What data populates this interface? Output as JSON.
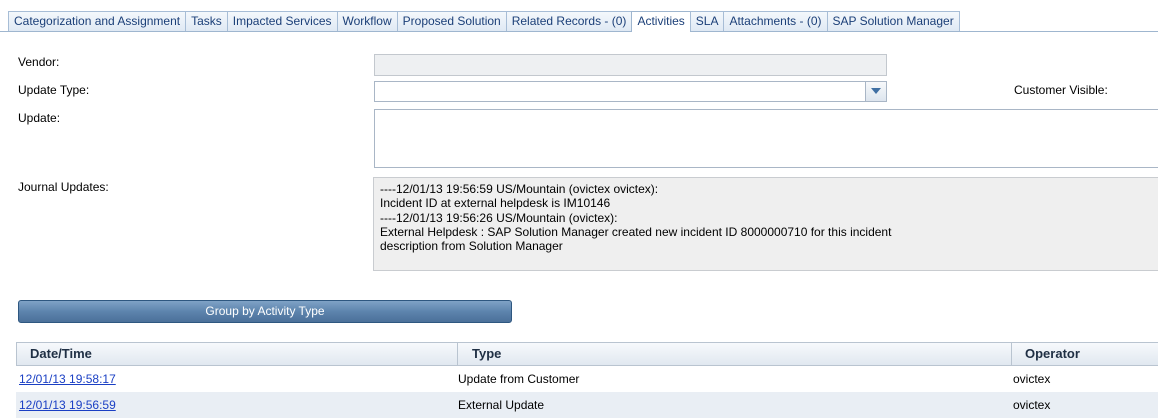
{
  "tabs": [
    {
      "label": "Categorization and Assignment",
      "active": false
    },
    {
      "label": "Tasks",
      "active": false
    },
    {
      "label": "Impacted Services",
      "active": false
    },
    {
      "label": "Workflow",
      "active": false
    },
    {
      "label": "Proposed Solution",
      "active": false
    },
    {
      "label": "Related Records - (0)",
      "active": false
    },
    {
      "label": "Activities",
      "active": true
    },
    {
      "label": "SLA",
      "active": false
    },
    {
      "label": "Attachments - (0)",
      "active": false
    },
    {
      "label": "SAP Solution Manager",
      "active": false
    }
  ],
  "form": {
    "vendor_label": "Vendor:",
    "vendor_value": "",
    "update_type_label": "Update Type:",
    "update_type_value": "",
    "customer_visible_label": "Customer Visible:",
    "update_label": "Update:",
    "update_value": "",
    "journal_label": "Journal Updates:",
    "journal_lines": [
      "----12/01/13 19:56:59 US/Mountain (ovictex ovictex):",
      "Incident ID at external helpdesk is IM10146",
      "----12/01/13 19:56:26 US/Mountain (ovictex):",
      "External Helpdesk : SAP Solution Manager created new incident ID 8000000710 for this incident",
      "description from Solution Manager"
    ]
  },
  "group_button_label": "Group by Activity Type",
  "activities": {
    "columns": [
      "Date/Time",
      "Type",
      "Operator"
    ],
    "rows": [
      {
        "datetime": "12/01/13 19:58:17",
        "type": "Update from Customer",
        "operator": "ovictex"
      },
      {
        "datetime": "12/01/13 19:56:59",
        "type": "External Update",
        "operator": "ovictex"
      }
    ]
  },
  "icons": {
    "dropdown": "chevron-down-icon"
  },
  "colors": {
    "tab_text": "#1b3f78",
    "button": "#5d84ad",
    "link": "#1a3fc4"
  }
}
